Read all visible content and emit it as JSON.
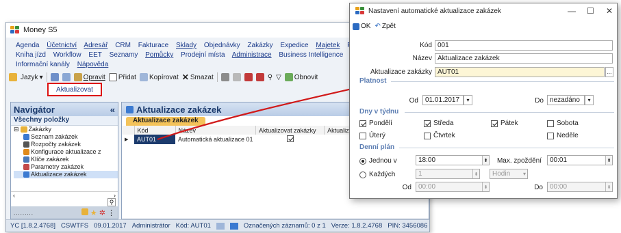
{
  "main_window": {
    "title": "Money S5",
    "menu_row1": [
      "Agenda",
      "Účetnictví",
      "Adresář",
      "CRM",
      "Fakturace",
      "Sklady",
      "Objednávky",
      "Zakázky",
      "Expedice",
      "Majetek",
      "P"
    ],
    "menu_row2": [
      "Kniha jízd",
      "Workflow",
      "EET",
      "Seznamy",
      "Pomůcky",
      "Prodejní místa",
      "Administrace",
      "Business Intelligence",
      "Da"
    ],
    "menu_row3": [
      "Informační kanály",
      "Nápověda"
    ],
    "toolbar": {
      "jazyk": "Jazyk",
      "opravit": "Opravit",
      "pridat": "Přidat",
      "kopirovat": "Kopírovat",
      "smazat": "Smazat",
      "obnovit": "Obnovit"
    },
    "aktualizovat_button": "Aktualizovat",
    "navigator": {
      "title": "Navigátor",
      "collapse": "«",
      "subtitle": "Všechny položky",
      "items": [
        "Zakázky",
        "Seznam zakázek",
        "Rozpočty zakázek",
        "Konfigurace aktualizace z",
        "Klíče zakázek",
        "Parametry zakázek",
        "Aktualizace zakázek"
      ],
      "dots": "........."
    },
    "content": {
      "title": "Aktualizace zakázek",
      "tab": "Aktualizace zakázek",
      "columns": [
        "Kód",
        "Název",
        "Aktualizovat zakázky",
        "Aktualizov"
      ],
      "rows": [
        {
          "kod": "AUT01",
          "nazev": "Automatická aktualizace 01",
          "aktualizovat": true
        }
      ]
    },
    "status": {
      "version_short": "YC [1.8.2.4768]",
      "server": "CSWTFS",
      "date": "09.01.2017",
      "user": "Administrátor",
      "code": "Kód: AUT01",
      "records": "Označených záznamů: 0 z 1",
      "version": "Verze: 1.8.2.4768",
      "pin": "PIN: 3456086"
    }
  },
  "dialog": {
    "title": "Nastavení automatické aktualizace zakázek",
    "ok": "OK",
    "back": "Zpět",
    "fields": {
      "kod_label": "Kód",
      "kod_value": "001",
      "nazev_label": "Název",
      "nazev_value": "Aktualizace zakázek",
      "aktualizace_label": "Aktualizace zakázky",
      "aktualizace_value": "AUT01",
      "ellipsis": "..."
    },
    "platnost": {
      "title": "Platnost",
      "od_label": "Od",
      "od_value": "01.01.2017",
      "do_label": "Do",
      "do_value": "nezadáno"
    },
    "days": {
      "title": "Dny v týdnu",
      "items": [
        {
          "label": "Pondělí",
          "checked": true
        },
        {
          "label": "Středa",
          "checked": true
        },
        {
          "label": "Pátek",
          "checked": true
        },
        {
          "label": "Sobota",
          "checked": false
        },
        {
          "label": "Úterý",
          "checked": false
        },
        {
          "label": "Čtvrtek",
          "checked": false
        },
        {
          "label": "Neděle",
          "checked": false
        }
      ]
    },
    "plan": {
      "title": "Denní plán",
      "once_label": "Jednou v",
      "once_value": "18:00",
      "max_label": "Max. zpoždění",
      "max_value": "00:01",
      "every_label": "Každých",
      "every_value": "1",
      "every_unit": "Hodin",
      "od_label": "Od",
      "od_value": "00:00",
      "do_label": "Do",
      "do_value": "00:00"
    }
  },
  "colors": {
    "annotation": "#d11a1a",
    "accent": "#1c3b6d",
    "tab": "#f4c35a"
  }
}
